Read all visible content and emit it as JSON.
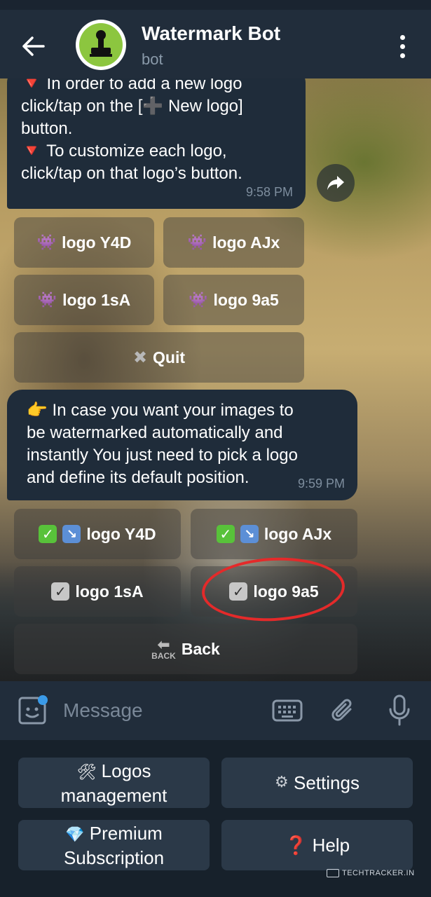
{
  "header": {
    "title": "Watermark Bot",
    "subtitle": "bot"
  },
  "messages": [
    {
      "lines": [
        "🔻 In order to add a new logo",
        "click/tap on the [➕ New logo]",
        "button.",
        "🔻 To customize each logo,",
        "click/tap on that logo’s button."
      ],
      "time": "9:58 PM"
    },
    {
      "lines": [
        "👉 In case you want your images to",
        "be watermarked automatically and",
        "instantly You just need to pick a logo",
        "and define its default position."
      ],
      "time": "9:59 PM"
    }
  ],
  "keyboard1": {
    "logo_y4d": "logo Y4D",
    "logo_ajx": "logo AJx",
    "logo_1sa": "logo 1sA",
    "logo_9a5": "logo 9a5",
    "quit": "Quit"
  },
  "keyboard2": {
    "logo_y4d": "logo Y4D",
    "logo_ajx": "logo AJx",
    "logo_1sa": "logo 1sA",
    "logo_9a5": "logo 9a5",
    "back": "Back",
    "back_icon_text": "BACK"
  },
  "input": {
    "placeholder": "Message"
  },
  "reply_keyboard": {
    "logos_management_line1": "Logos",
    "logos_management_line2": "management",
    "settings": "Settings",
    "premium_line1": "Premium",
    "premium_line2": "Subscription",
    "help": "Help"
  },
  "watermark": "TECHTRACKER.IN",
  "colors": {
    "header_bg": "#212d3b",
    "bubble_bg": "#1f2c3a",
    "highlight_circle": "#e42a2a",
    "accent_blue": "#3a9ae8"
  }
}
